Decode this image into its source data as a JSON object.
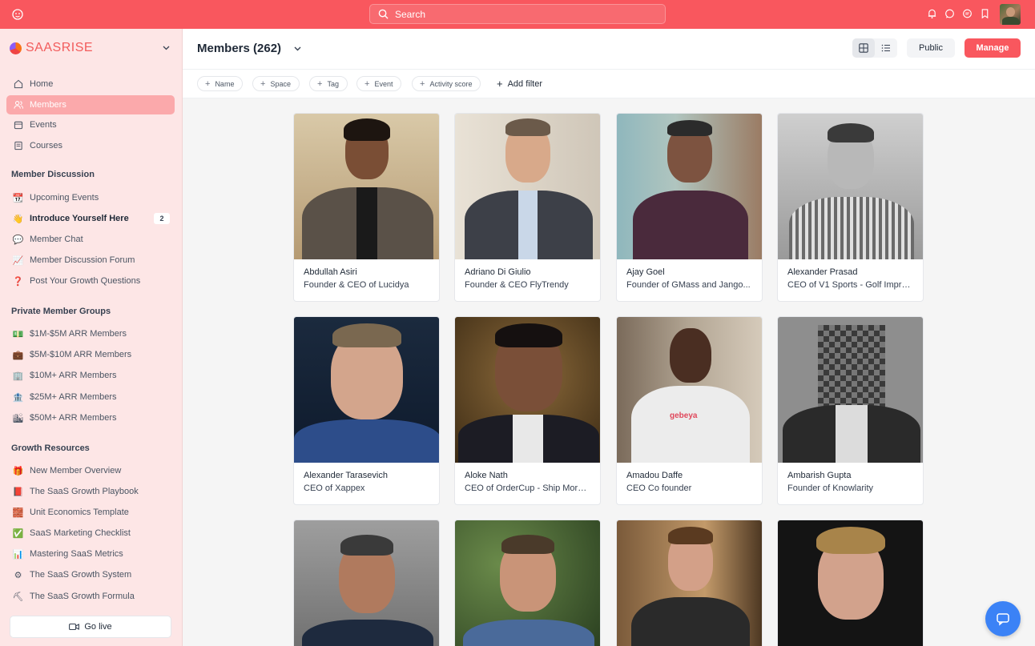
{
  "topbar": {
    "search_placeholder": "Search"
  },
  "sidebar": {
    "brand": "SAASRISE",
    "nav": [
      {
        "label": "Home",
        "icon": "home-icon"
      },
      {
        "label": "Members",
        "icon": "members-icon",
        "active": true
      },
      {
        "label": "Events",
        "icon": "calendar-icon"
      },
      {
        "label": "Courses",
        "icon": "courses-icon"
      }
    ],
    "sections": [
      {
        "title": "Member Discussion",
        "items": [
          {
            "label": "Upcoming Events",
            "emoji": "📆"
          },
          {
            "label": "Introduce Yourself Here",
            "emoji": "👋",
            "badge": "2"
          },
          {
            "label": "Member Chat",
            "emoji": "💬"
          },
          {
            "label": "Member Discussion Forum",
            "emoji": "📈"
          },
          {
            "label": "Post Your Growth Questions",
            "emoji": "❓"
          }
        ]
      },
      {
        "title": "Private Member Groups",
        "items": [
          {
            "label": "$1M-$5M ARR Members",
            "emoji": "💵"
          },
          {
            "label": "$5M-$10M ARR Members",
            "emoji": "💼"
          },
          {
            "label": "$10M+ ARR Members",
            "emoji": "🏢"
          },
          {
            "label": "$25M+ ARR Members",
            "emoji": "🏦"
          },
          {
            "label": "$50M+ ARR Members",
            "emoji": "🏙"
          }
        ]
      },
      {
        "title": "Growth Resources",
        "items": [
          {
            "label": "New Member Overview",
            "emoji": "🎁"
          },
          {
            "label": "The SaaS Growth Playbook",
            "emoji": "📕"
          },
          {
            "label": "Unit Economics Template",
            "emoji": "🧱"
          },
          {
            "label": "SaaS Marketing Checklist",
            "emoji": "✅"
          },
          {
            "label": "Mastering SaaS Metrics",
            "emoji": "📊"
          },
          {
            "label": "The SaaS Growth System",
            "emoji": "⚙"
          },
          {
            "label": "The SaaS Growth Formula",
            "emoji": "⛏"
          }
        ]
      }
    ],
    "go_live": "Go live"
  },
  "header": {
    "title": "Members (262)",
    "public_label": "Public",
    "manage_label": "Manage"
  },
  "filters": {
    "chips": [
      "Name",
      "Space",
      "Tag",
      "Event",
      "Activity score"
    ],
    "add_filter": "Add filter"
  },
  "members": [
    {
      "name": "Abdullah Asiri",
      "role": "Founder & CEO of Lucidya"
    },
    {
      "name": "Adriano Di Giulio",
      "role": "Founder & CEO FlyTrendy"
    },
    {
      "name": "Ajay Goel",
      "role": "Founder of GMass and Jango..."
    },
    {
      "name": "Alexander Prasad",
      "role": "CEO of V1 Sports - Golf Impro..."
    },
    {
      "name": "Alexander Tarasevich",
      "role": "CEO of Xappex"
    },
    {
      "name": "Aloke Nath",
      "role": "CEO of OrderCup - Ship More,..."
    },
    {
      "name": "Amadou Daffe",
      "role": "CEO Co founder"
    },
    {
      "name": "Ambarish Gupta",
      "role": "Founder of Knowlarity"
    },
    {
      "name": "",
      "role": ""
    },
    {
      "name": "",
      "role": ""
    },
    {
      "name": "",
      "role": ""
    },
    {
      "name": "",
      "role": ""
    }
  ],
  "colors": {
    "accent": "#f9575e",
    "sidebar_bg": "#fde6e6",
    "active_nav": "#fba9ab",
    "chat_fab": "#3b82f6"
  }
}
